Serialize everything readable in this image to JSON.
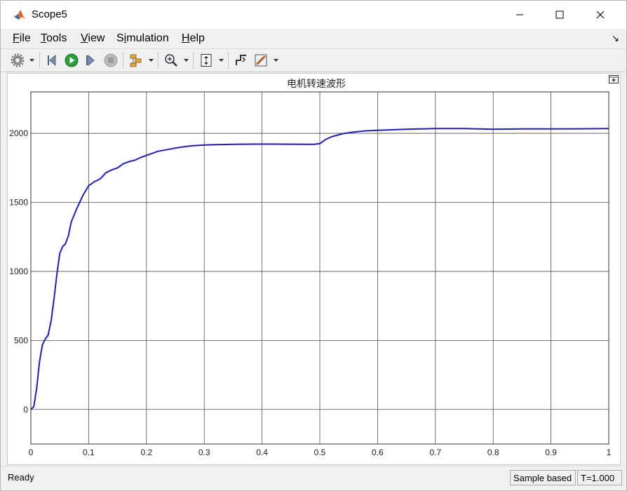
{
  "window": {
    "title": "Scope5",
    "app_icon": "matlab-icon",
    "controls": [
      "minimize-icon",
      "maximize-icon",
      "close-icon"
    ]
  },
  "menu": {
    "items": [
      {
        "label": "File",
        "mnemonic": "F"
      },
      {
        "label": "Tools",
        "mnemonic": "T"
      },
      {
        "label": "View",
        "mnemonic": "V"
      },
      {
        "label": "Simulation",
        "mnemonic": "i"
      },
      {
        "label": "Help",
        "mnemonic": "H"
      }
    ]
  },
  "toolbar": {
    "buttons": [
      "gear-icon",
      "step-back-icon",
      "run-icon",
      "step-forward-icon",
      "stop-icon",
      "signal-selector-icon",
      "zoom-in-icon",
      "autoscale-icon",
      "triggers-icon",
      "measurements-icon"
    ]
  },
  "status": {
    "ready": "Ready",
    "mode": "Sample based",
    "time": "T=1.000"
  },
  "colors": {
    "line": "#1e1eb4",
    "grid": "#4d4d4d"
  },
  "chart_data": {
    "type": "line",
    "title": "电机转速波形",
    "xlabel": "",
    "ylabel": "",
    "xlim": [
      0,
      1
    ],
    "ylim": [
      -250,
      2300
    ],
    "xticks": [
      0,
      0.1,
      0.2,
      0.3,
      0.4,
      0.5,
      0.6,
      0.7,
      0.8,
      0.9,
      1
    ],
    "xtick_labels": [
      "0",
      "0.1",
      "0.2",
      "0.3",
      "0.4",
      "0.5",
      "0.6",
      "0.7",
      "0.8",
      "0.9",
      "1"
    ],
    "yticks": [
      0,
      500,
      1000,
      1500,
      2000
    ],
    "ytick_labels": [
      "0",
      "500",
      "1000",
      "1500",
      "2000"
    ],
    "grid": true,
    "series": [
      {
        "x": [
          0,
          0.005,
          0.01,
          0.015,
          0.02,
          0.025,
          0.03,
          0.035,
          0.04,
          0.045,
          0.05,
          0.055,
          0.06,
          0.065,
          0.07,
          0.075,
          0.08,
          0.09,
          0.1,
          0.11,
          0.12,
          0.13,
          0.14,
          0.15,
          0.16,
          0.17,
          0.18,
          0.19,
          0.2,
          0.22,
          0.24,
          0.26,
          0.28,
          0.3,
          0.32,
          0.35,
          0.4,
          0.45,
          0.49,
          0.5,
          0.51,
          0.52,
          0.54,
          0.56,
          0.58,
          0.6,
          0.65,
          0.7,
          0.75,
          0.8,
          0.85,
          0.9,
          0.95,
          1.0
        ],
        "y": [
          0,
          20,
          150,
          350,
          470,
          510,
          540,
          640,
          800,
          980,
          1130,
          1180,
          1200,
          1260,
          1360,
          1410,
          1460,
          1550,
          1620,
          1650,
          1670,
          1715,
          1735,
          1750,
          1780,
          1795,
          1805,
          1825,
          1840,
          1870,
          1885,
          1900,
          1910,
          1915,
          1918,
          1920,
          1922,
          1921,
          1920,
          1925,
          1955,
          1975,
          1998,
          2010,
          2018,
          2022,
          2030,
          2035,
          2035,
          2030,
          2032,
          2032,
          2033,
          2035
        ]
      }
    ]
  }
}
